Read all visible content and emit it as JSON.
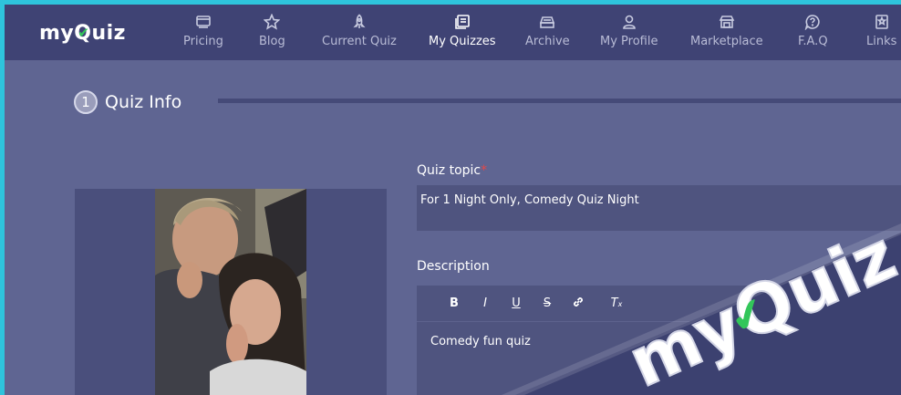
{
  "brand": {
    "logo_text_pre": "my",
    "logo_text_post": "uiz",
    "logo_q": "Q",
    "check_color": "#33c65a"
  },
  "nav": {
    "items": [
      {
        "label": "Pricing",
        "icon": "pricing-icon"
      },
      {
        "label": "Blog",
        "icon": "star-icon"
      },
      {
        "label": "Current Quiz",
        "icon": "rocket-icon"
      },
      {
        "label": "My Quizzes",
        "icon": "quizzes-icon",
        "active": true
      },
      {
        "label": "Archive",
        "icon": "archive-icon"
      },
      {
        "label": "My Profile",
        "icon": "user-icon"
      },
      {
        "label": "Marketplace",
        "icon": "marketplace-icon"
      },
      {
        "label": "F.A.Q",
        "icon": "faq-icon"
      },
      {
        "label": "Links",
        "icon": "links-icon"
      }
    ]
  },
  "step": {
    "number": "1",
    "title": "Quiz Info"
  },
  "form": {
    "topic_label": "Quiz topic",
    "topic_required": "*",
    "topic_value": "For 1 Night Only, Comedy Quiz Night",
    "description_label": "Description",
    "description_value": "Comedy fun quiz",
    "toolbar": [
      {
        "label": "B",
        "icon": "bold-icon"
      },
      {
        "label": "I",
        "icon": "italic-icon"
      },
      {
        "label": "U",
        "icon": "underline-icon"
      },
      {
        "label": "S",
        "icon": "strikethrough-icon"
      },
      {
        "label": "",
        "icon": "link-icon"
      },
      {
        "label": "T",
        "icon": "clear-format-icon"
      }
    ]
  },
  "watermark": {
    "pre": "my",
    "post": "uiz",
    "q": "Q"
  },
  "colors": {
    "accent": "#2ec4dc",
    "nav_bg": "#3f4374",
    "page_bg": "#5f6592",
    "required": "#e54848"
  }
}
